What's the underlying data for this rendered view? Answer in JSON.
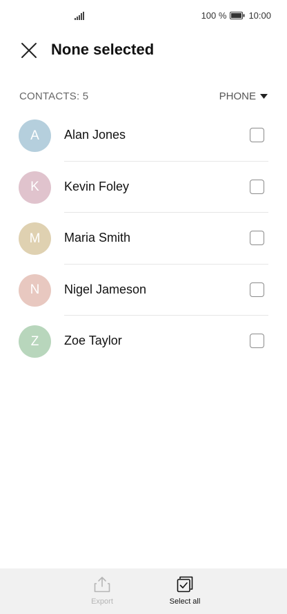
{
  "status_bar": {
    "battery_percent": "100 %",
    "time": "10:00",
    "icons": [
      "signal-icon",
      "battery-icon"
    ]
  },
  "header": {
    "title": "None selected",
    "close_icon": "close-icon"
  },
  "subheader": {
    "count_label": "CONTACTS: 5",
    "filter_label": "PHONE",
    "filter_icon": "caret-down-icon"
  },
  "contacts": [
    {
      "initial": "A",
      "name": "Alan Jones",
      "color": "#b5cfdd",
      "checked": false
    },
    {
      "initial": "K",
      "name": "Kevin Foley",
      "color": "#e0c3cd",
      "checked": false
    },
    {
      "initial": "M",
      "name": "Maria Smith",
      "color": "#dfd1b1",
      "checked": false
    },
    {
      "initial": "N",
      "name": "Nigel Jameson",
      "color": "#e8c8c0",
      "checked": false
    },
    {
      "initial": "Z",
      "name": "Zoe Taylor",
      "color": "#b8d6bc",
      "checked": false
    }
  ],
  "bottom_bar": {
    "export_label": "Export",
    "export_icon": "export-icon",
    "export_enabled": false,
    "select_all_label": "Select all",
    "select_all_icon": "select-all-icon"
  }
}
